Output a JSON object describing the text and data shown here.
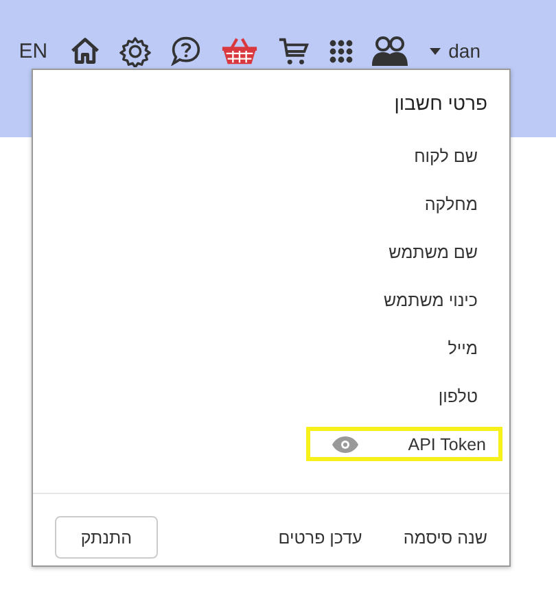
{
  "topbar": {
    "language": "EN",
    "icons": [
      {
        "kind": "home"
      },
      {
        "kind": "gear"
      },
      {
        "kind": "help"
      },
      {
        "kind": "basket"
      },
      {
        "kind": "cart"
      },
      {
        "kind": "grid"
      },
      {
        "kind": "people"
      }
    ],
    "user": "dan"
  },
  "account_menu": {
    "title": "פרטי חשבון",
    "fields": [
      {
        "label": "שם לקוח",
        "highlighted": false
      },
      {
        "label": "מחלקה",
        "highlighted": false
      },
      {
        "label": "שם משתמש",
        "highlighted": false
      },
      {
        "label": "כינוי משתמש",
        "highlighted": false
      },
      {
        "label": "מייל",
        "highlighted": false
      },
      {
        "label": "טלפון",
        "highlighted": false
      },
      {
        "label": "API Token",
        "kind": "token",
        "highlighted": true
      }
    ],
    "links": [
      "שנה סיסמה",
      "עדכן פרטים"
    ],
    "logout_button": "התנתק"
  }
}
